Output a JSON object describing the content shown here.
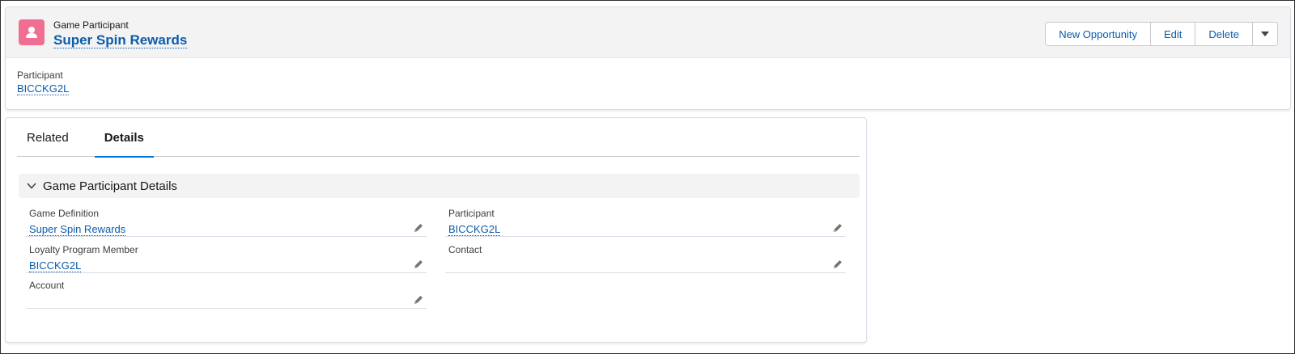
{
  "header": {
    "entity_label": "Game Participant",
    "record_title": "Super Spin Rewards",
    "icon": "user-icon",
    "icon_color": "#ef6e92",
    "actions": {
      "new_opportunity": "New Opportunity",
      "edit": "Edit",
      "delete": "Delete"
    }
  },
  "highlights": {
    "field_label": "Participant",
    "field_value": "BICCKG2L"
  },
  "tabs": [
    {
      "label": "Related",
      "active": false
    },
    {
      "label": "Details",
      "active": true
    }
  ],
  "section": {
    "title": "Game Participant Details"
  },
  "fields": {
    "game_definition": {
      "label": "Game Definition",
      "value": "Super Spin Rewards"
    },
    "participant": {
      "label": "Participant",
      "value": "BICCKG2L"
    },
    "loyalty_program_member": {
      "label": "Loyalty Program Member",
      "value": "BICCKG2L"
    },
    "contact": {
      "label": "Contact",
      "value": ""
    },
    "account": {
      "label": "Account",
      "value": ""
    }
  },
  "colors": {
    "link": "#0b5cab",
    "active_tab": "#0176d3"
  }
}
